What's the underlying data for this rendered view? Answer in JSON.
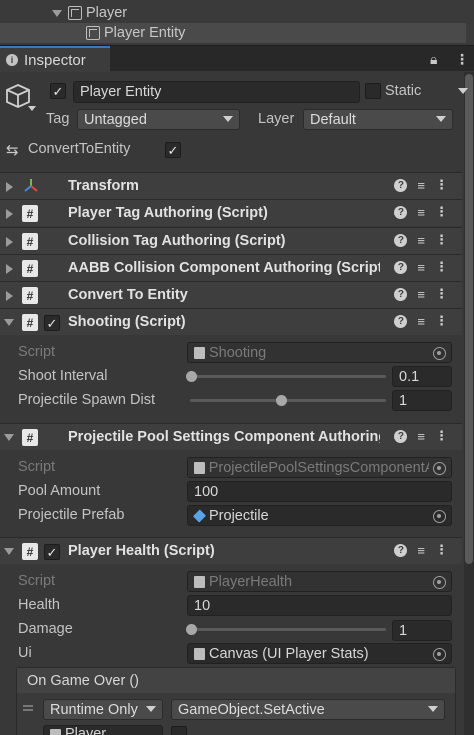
{
  "hierarchy": {
    "parent": "Player",
    "child": "Player Entity"
  },
  "tab": {
    "label": "Inspector"
  },
  "header": {
    "name": "Player Entity",
    "static_label": "Static",
    "tag_label": "Tag",
    "tag_value": "Untagged",
    "layer_label": "Layer",
    "layer_value": "Default",
    "convert_label": "ConvertToEntity"
  },
  "components": [
    {
      "title": "Transform"
    },
    {
      "title": "Player Tag Authoring (Script)"
    },
    {
      "title": "Collision Tag Authoring (Script)"
    },
    {
      "title": "AABB Collision Component Authoring (Script)"
    },
    {
      "title": "Convert To Entity"
    },
    {
      "title": "Shooting (Script)"
    },
    {
      "title": "Projectile Pool Settings Component Authoring (Script)"
    },
    {
      "title": "Player Health (Script)"
    }
  ],
  "shooting": {
    "script_label": "Script",
    "script_value": "Shooting",
    "shoot_interval_label": "Shoot Interval",
    "shoot_interval_value": "0.1",
    "spawn_dist_label": "Projectile Spawn Dist",
    "spawn_dist_value": "1"
  },
  "pool": {
    "script_label": "Script",
    "script_value": "ProjectilePoolSettingsComponentAuthoring",
    "amount_label": "Pool Amount",
    "amount_value": "100",
    "prefab_label": "Projectile Prefab",
    "prefab_value": "Projectile"
  },
  "health": {
    "script_label": "Script",
    "script_value": "PlayerHealth",
    "health_label": "Health",
    "health_value": "10",
    "damage_label": "Damage",
    "damage_value": "1",
    "ui_label": "Ui",
    "ui_value": "Canvas (UI Player Stats)"
  },
  "event": {
    "title": "On Game Over ()",
    "runtime": "Runtime Only",
    "function": "GameObject.SetActive",
    "target": "Player"
  }
}
